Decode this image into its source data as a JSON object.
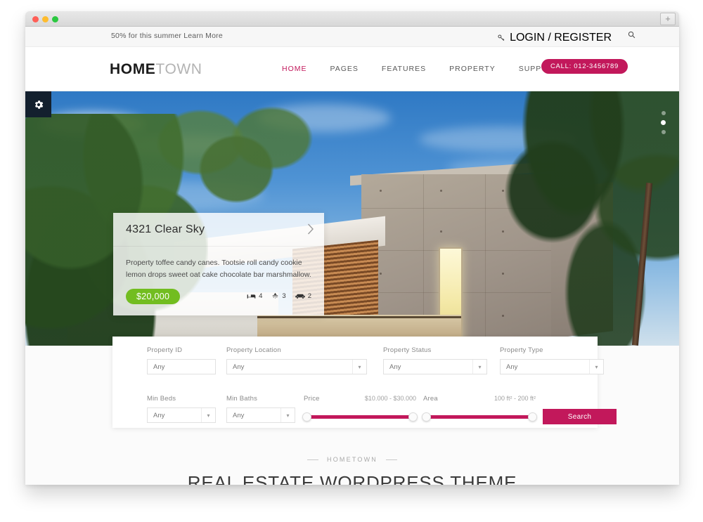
{
  "browser": {
    "newtab_label": "+"
  },
  "topbar": {
    "promo": "50% for this summer Learn More",
    "login_label": "LOGIN / REGISTER",
    "key_icon": "key-icon",
    "search_icon": "search-icon"
  },
  "nav": {
    "logo_bold": "HOME",
    "logo_light": "TOWN",
    "links": [
      {
        "label": "HOME",
        "active": true
      },
      {
        "label": "PAGES",
        "active": false
      },
      {
        "label": "FEATURES",
        "active": false
      },
      {
        "label": "PROPERTY",
        "active": false
      },
      {
        "label": "SUPPORT",
        "active": false
      }
    ],
    "call_label": "CALL: 012-3456789",
    "accent_color": "#c2185b"
  },
  "hero": {
    "settings_icon": "gear-icon",
    "slider_dots": 3,
    "active_dot": 2,
    "card": {
      "title": "4321 Clear Sky",
      "next_icon": "chevron-right-icon",
      "description": "Property toffee candy canes. Tootsie roll candy cookie lemon drops sweet oat cake chocolate bar marshmallow.",
      "price": "$20,000",
      "price_color": "#72bd20",
      "stats": [
        {
          "icon": "bed-icon",
          "value": "4"
        },
        {
          "icon": "shower-icon",
          "value": "3"
        },
        {
          "icon": "car-icon",
          "value": "2"
        }
      ]
    }
  },
  "search": {
    "property_id": {
      "label": "Property ID",
      "placeholder": "Any"
    },
    "property_location": {
      "label": "Property Location",
      "value": "Any"
    },
    "property_status": {
      "label": "Property Status",
      "value": "Any"
    },
    "property_type": {
      "label": "Property Type",
      "value": "Any"
    },
    "min_beds": {
      "label": "Min Beds",
      "value": "Any"
    },
    "min_baths": {
      "label": "Min Baths",
      "value": "Any"
    },
    "price": {
      "label": "Price",
      "range": "$10.000 - $30.000"
    },
    "area": {
      "label": "Area",
      "range": "100 ft² - 200 ft²"
    },
    "submit_label": "Search",
    "accent_color": "#c2185b"
  },
  "below": {
    "eyebrow": "HOMETOWN",
    "title": "REAL ESTATE WORDPRESS THEME"
  }
}
